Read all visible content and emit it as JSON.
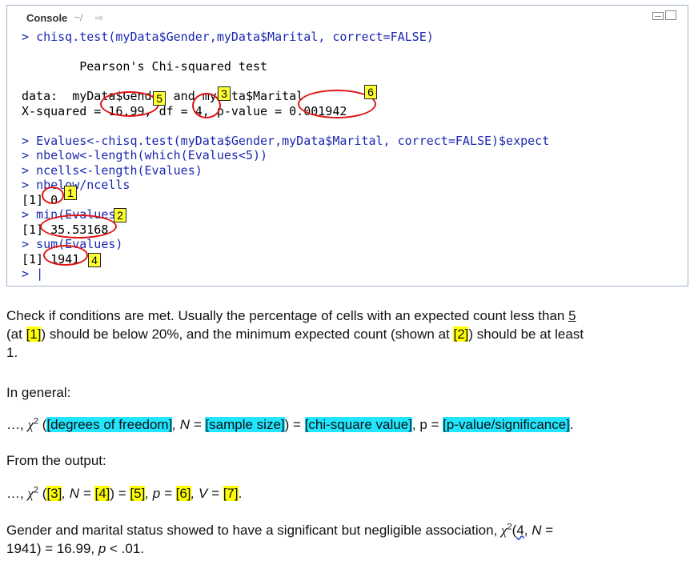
{
  "console": {
    "title": "Console",
    "path": "~/",
    "lines": [
      {
        "prompt": "> ",
        "text": "chisq.test(myData$Gender,myData$Marital, correct=FALSE)"
      },
      {
        "prompt": "",
        "text": ""
      },
      {
        "prompt": "",
        "text": "        Pearson's Chi-squared test"
      },
      {
        "prompt": "",
        "text": ""
      },
      {
        "prompt": "",
        "text": "data:  myData$Gender and myData$Marital"
      },
      {
        "prompt": "",
        "text": "X-squared = 16.99, df = 4, p-value = 0.001942"
      },
      {
        "prompt": "",
        "text": ""
      },
      {
        "prompt": "> ",
        "text": "Evalues<-chisq.test(myData$Gender,myData$Marital, correct=FALSE)$expect"
      },
      {
        "prompt": "> ",
        "text": "nbelow<-length(which(Evalues<5))"
      },
      {
        "prompt": "> ",
        "text": "ncells<-length(Evalues)"
      },
      {
        "prompt": "> ",
        "text": "nbelow/ncells"
      },
      {
        "prompt": "",
        "text": "[1] 0"
      },
      {
        "prompt": "> ",
        "text": "min(Evalues)"
      },
      {
        "prompt": "",
        "text": "[1] 35.53168"
      },
      {
        "prompt": "> ",
        "text": "sum(Evalues)"
      },
      {
        "prompt": "",
        "text": "[1] 1941"
      },
      {
        "prompt": "> ",
        "text": "|"
      }
    ],
    "markers": [
      "1",
      "2",
      "3",
      "4",
      "5",
      "6"
    ]
  },
  "text": {
    "p1_a": "Check if conditions are met. Usually the percentage of cells with an expected count less than ",
    "p1_five": "5",
    "p1_b": "(at ",
    "p1_m1": "[1]",
    "p1_c": ") should be below 20%, and the minimum expected count (shown at ",
    "p1_m2": "[2]",
    "p1_d": ") should be at least",
    "p1_e": "1.",
    "p2": "In general:",
    "p3_pre": "…, ",
    "p3_chi": "χ",
    "p3_sup": "2",
    "p3_open": " (",
    "p3_df": "[degrees of freedom]",
    "p3_n": ", N = ",
    "p3_ss": "[sample size]",
    "p3_eq": ") = ",
    "p3_cv": "[chi-square value]",
    "p3_p": ", p = ",
    "p3_pv": "[p-value/significance]",
    "p3_end": ".",
    "p4": "From the output:",
    "p5_pre": "…, ",
    "p5_chi": "χ",
    "p5_sup": "2",
    "p5_open": " (",
    "p5_m3": "[3]",
    "p5_n": ", N = ",
    "p5_m4": "[4]",
    "p5_eq": ") = ",
    "p5_m5": "[5]",
    "p5_p": ", p = ",
    "p5_m6": "[6]",
    "p5_v": ", V = ",
    "p5_m7": "[7]",
    "p5_end": ".",
    "p6_a": "Gender and marital status showed to have a significant but negligible association, ",
    "p6_chi": "χ",
    "p6_sup": "2",
    "p6_b": "(",
    "p6_four": "4",
    "p6_c": ", ",
    "p6_n": "N",
    "p6_d": " =",
    "p6_e": "1941) = 16.99, ",
    "p6_p": "p",
    "p6_f": " < .01."
  }
}
